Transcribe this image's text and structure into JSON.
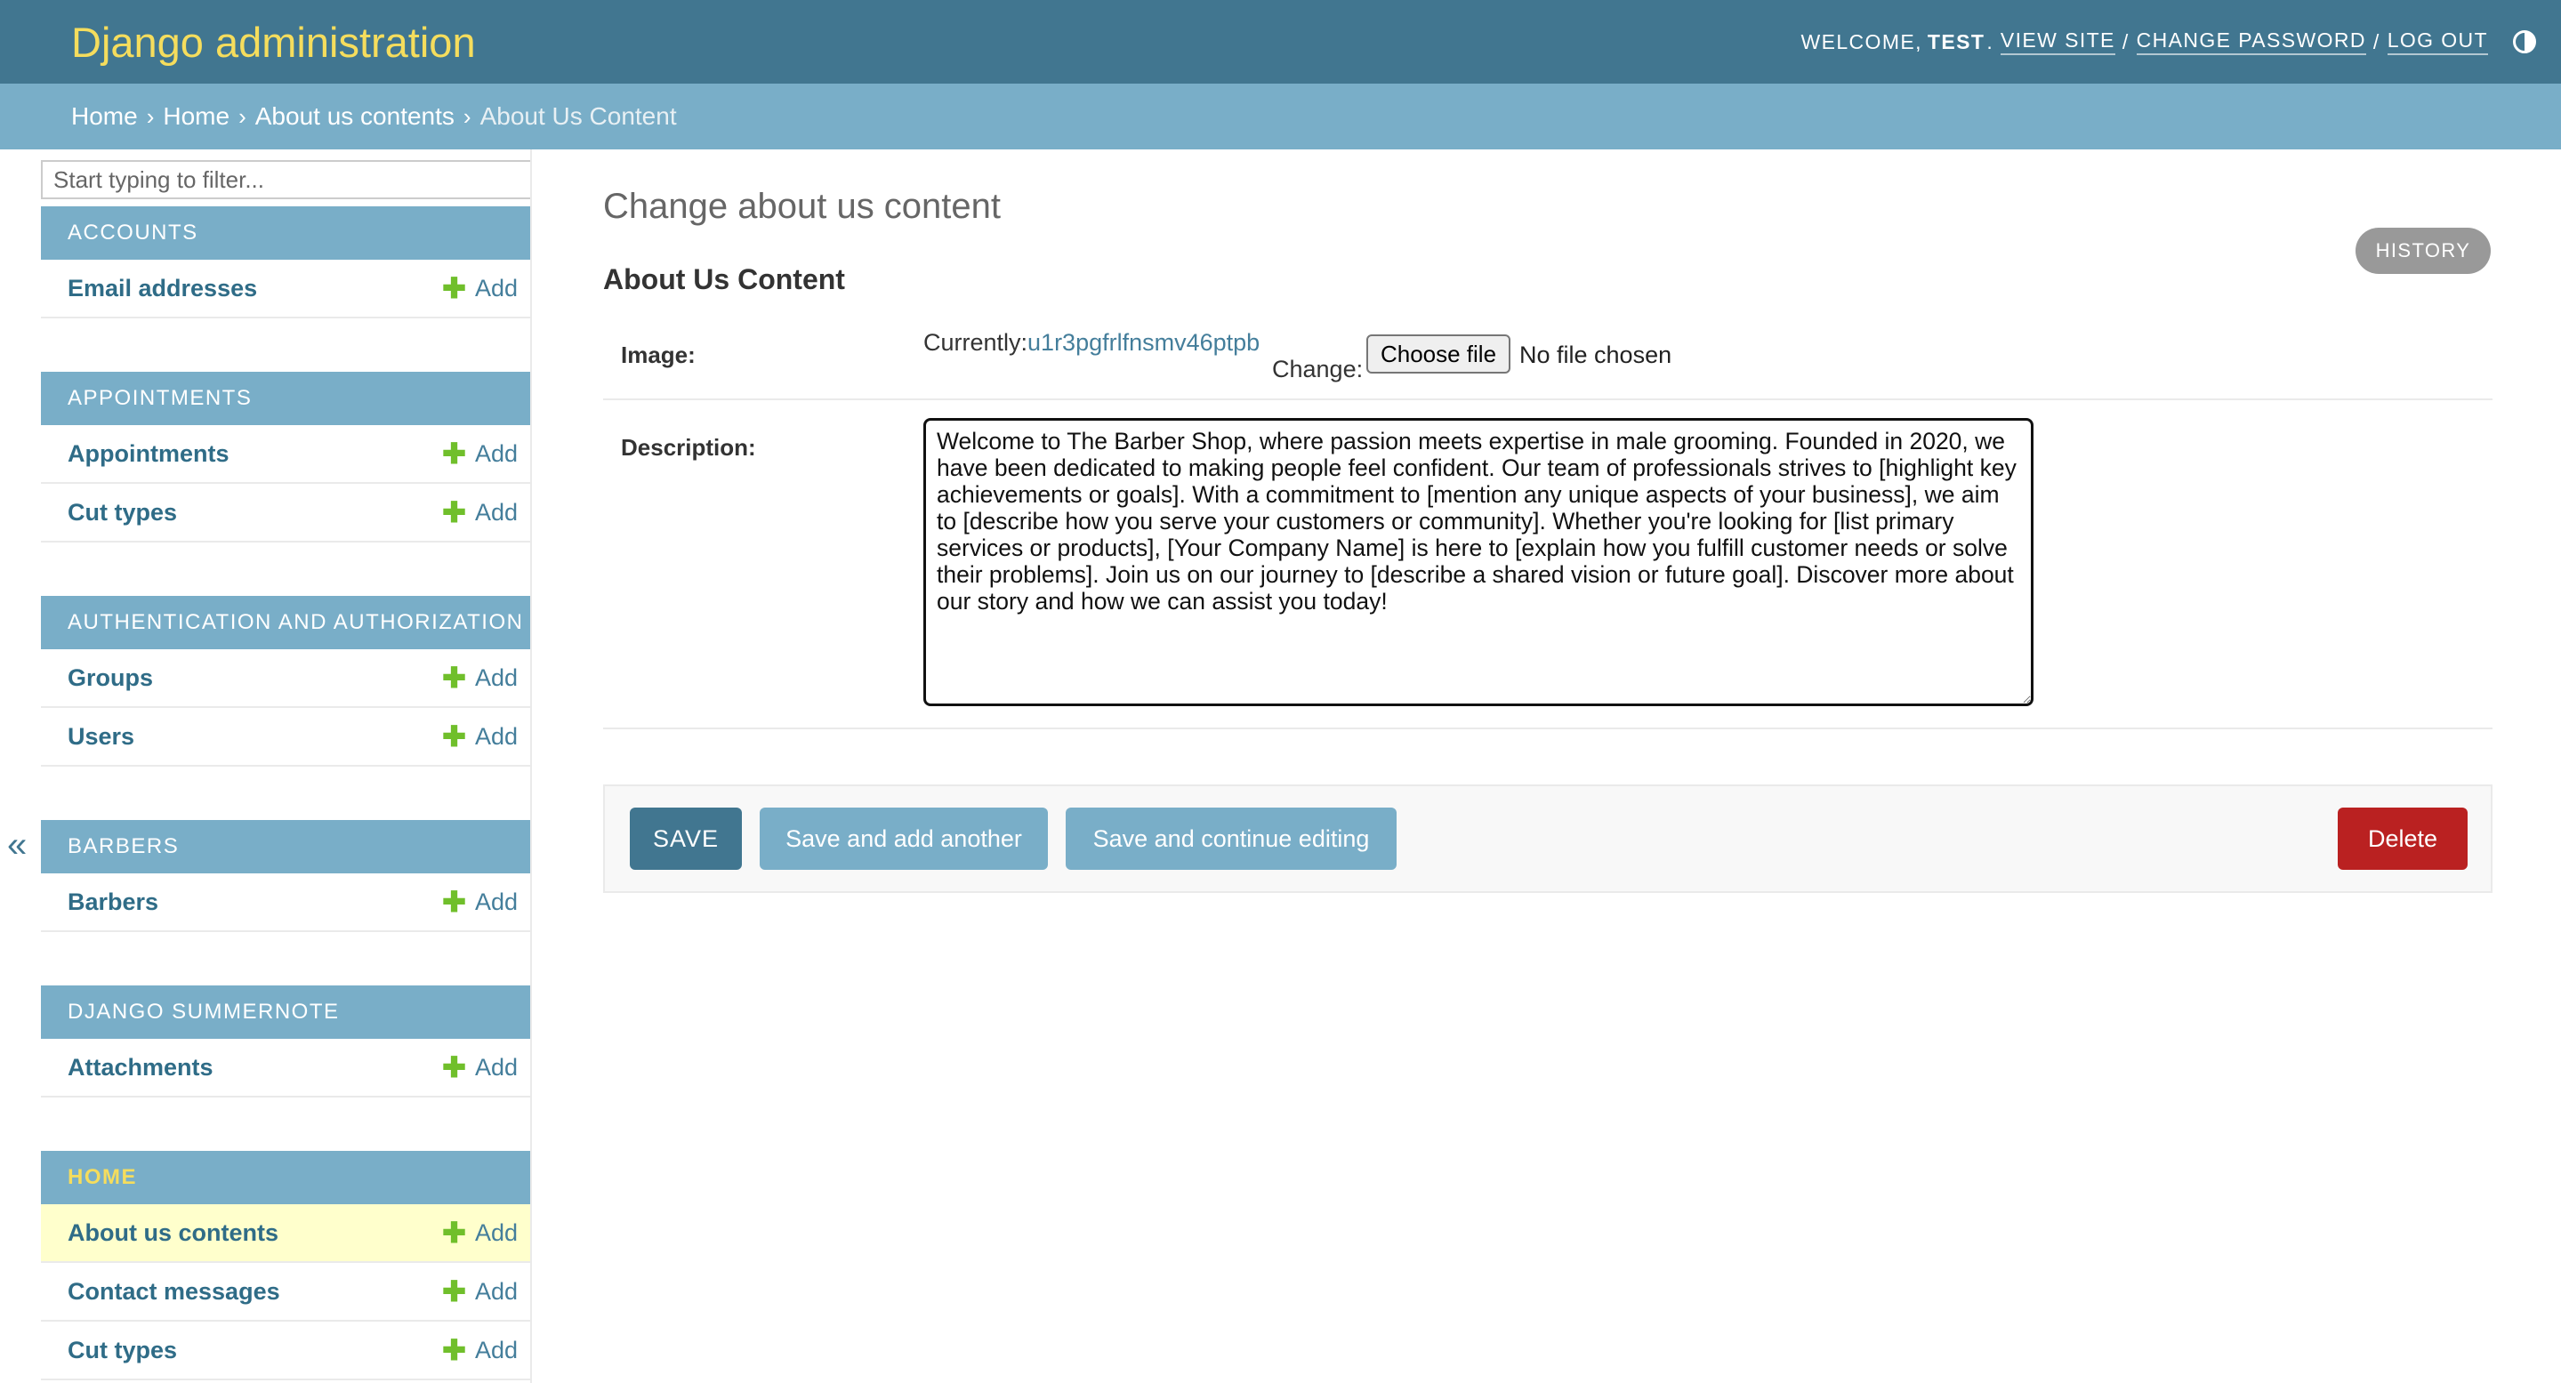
{
  "header": {
    "brand": "Django administration",
    "welcome": "Welcome,",
    "username": "Test",
    "view_site": "View site",
    "change_password": "Change password",
    "log_out": "Log out",
    "separator": "/"
  },
  "breadcrumbs": {
    "items": [
      "Home",
      "Home",
      "About us contents"
    ],
    "current": "About Us Content",
    "separator": "›"
  },
  "sidebar": {
    "filter_placeholder": "Start typing to filter...",
    "add_label": "Add",
    "collapse_glyph": "«",
    "modules": [
      {
        "caption": "Accounts",
        "models": [
          "Email addresses"
        ]
      },
      {
        "caption": "Appointments",
        "models": [
          "Appointments",
          "Cut types"
        ]
      },
      {
        "caption": "Authentication and Authorization",
        "models": [
          "Groups",
          "Users"
        ]
      },
      {
        "caption": "Barbers",
        "models": [
          "Barbers"
        ]
      },
      {
        "caption": "Django Summernote",
        "models": [
          "Attachments"
        ]
      },
      {
        "caption": "Home",
        "models": [
          "About us contents",
          "Contact messages",
          "Cut types"
        ]
      }
    ]
  },
  "main": {
    "page_title": "Change about us content",
    "history": "History",
    "fieldset_title": "About Us Content",
    "image": {
      "label": "Image:",
      "currently_label": "Currently:",
      "current_file": "u1r3pgfrlfnsmv46ptpb",
      "change_label": "Change:",
      "choose_file": "Choose file",
      "no_file": "No file chosen"
    },
    "description": {
      "label": "Description:",
      "value": "Welcome to The Barber Shop, where passion meets expertise in male grooming. Founded in 2020, we have been dedicated to making people feel confident. Our team of professionals strives to [highlight key achievements or goals]. With a commitment to [mention any unique aspects of your business], we aim to [describe how you serve your customers or community]. Whether you're looking for [list primary services or products], [Your Company Name] is here to [explain how you fulfill customer needs or solve their problems]. Join us on our journey to [describe a shared vision or future goal]. Discover more about our story and how we can assist you today!"
    },
    "buttons": {
      "save": "SAVE",
      "save_add_another": "Save and add another",
      "save_continue": "Save and continue editing",
      "delete": "Delete"
    }
  },
  "colors": {
    "header_bg": "#417690",
    "brand": "#f5dd5d",
    "breadcrumb_bg": "#79aec8",
    "selected_row": "#ffffcc",
    "delete": "#ba2121",
    "add_plus": "#70bf2b"
  }
}
